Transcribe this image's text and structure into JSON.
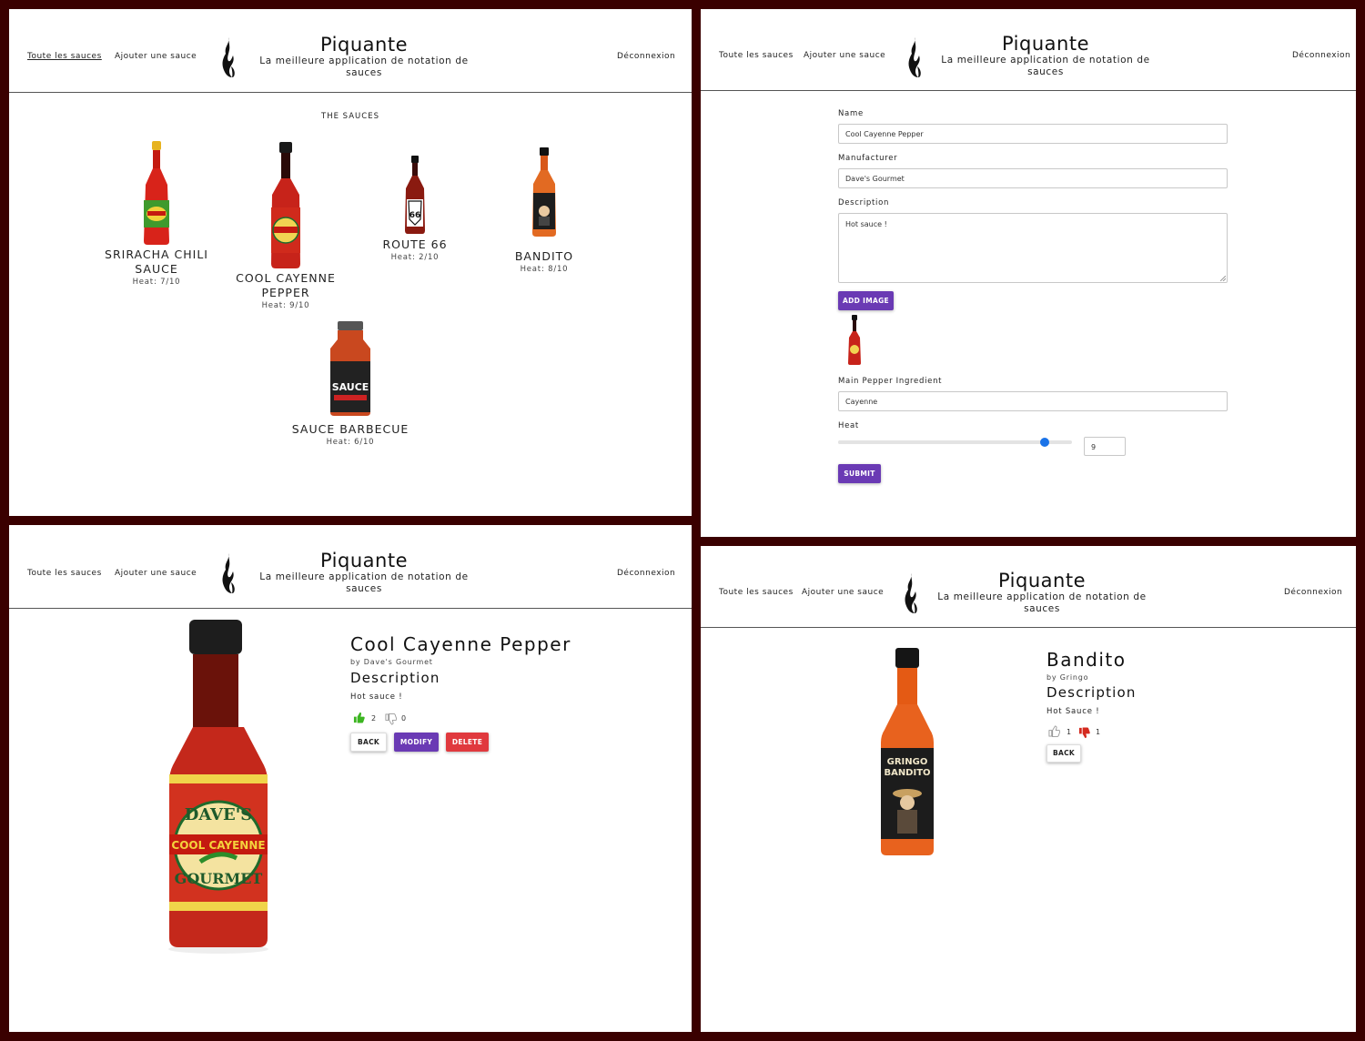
{
  "brand": {
    "title": "Piquante",
    "subtitle": "La meilleure application de notation de sauces"
  },
  "nav": {
    "all": "Toute les sauces",
    "add": "Ajouter une sauce",
    "logout": "Déconnexion"
  },
  "list": {
    "heading": "THE SAUCES",
    "sauces": [
      {
        "name": "SRIRACHA CHILI SAUCE",
        "heat": "Heat: 7/10"
      },
      {
        "name": "COOL CAYENNE PEPPER",
        "heat": "Heat: 9/10"
      },
      {
        "name": "ROUTE 66",
        "heat": "Heat: 2/10"
      },
      {
        "name": "BANDITO",
        "heat": "Heat: 8/10"
      },
      {
        "name": "SAUCE BARBECUE",
        "heat": "Heat: 6/10"
      }
    ]
  },
  "form": {
    "name_label": "Name",
    "name_value": "Cool Cayenne Pepper",
    "manufacturer_label": "Manufacturer",
    "manufacturer_value": "Dave's Gourmet",
    "description_label": "Description",
    "description_value": "Hot sauce !",
    "add_image": "ADD IMAGE",
    "pepper_label": "Main Pepper Ingredient",
    "pepper_value": "Cayenne",
    "heat_label": "Heat",
    "heat_value": "9",
    "heat_level": 9,
    "heat_max": 10,
    "submit": "SUBMIT"
  },
  "detail1": {
    "title": "Cool Cayenne Pepper",
    "by": "by Dave's Gourmet",
    "desc_heading": "Description",
    "desc": "Hot sauce !",
    "likes": "2",
    "dislikes": "0",
    "back": "BACK",
    "modify": "MODIFY",
    "delete": "DELETE"
  },
  "detail2": {
    "title": "Bandito",
    "by": "by Gringo",
    "desc_heading": "Description",
    "desc": "Hot Sauce !",
    "likes": "1",
    "dislikes": "1",
    "back": "BACK"
  },
  "colors": {
    "accent": "#6a3ab4",
    "danger": "#e0393e",
    "like": "#3cb521",
    "dislike": "#d42a1f",
    "slider": "#1a73e8",
    "frame": "#3a0000"
  },
  "icons": {
    "logo": "flame-icon",
    "like": "thumbs-up-icon",
    "dislike": "thumbs-down-icon"
  }
}
